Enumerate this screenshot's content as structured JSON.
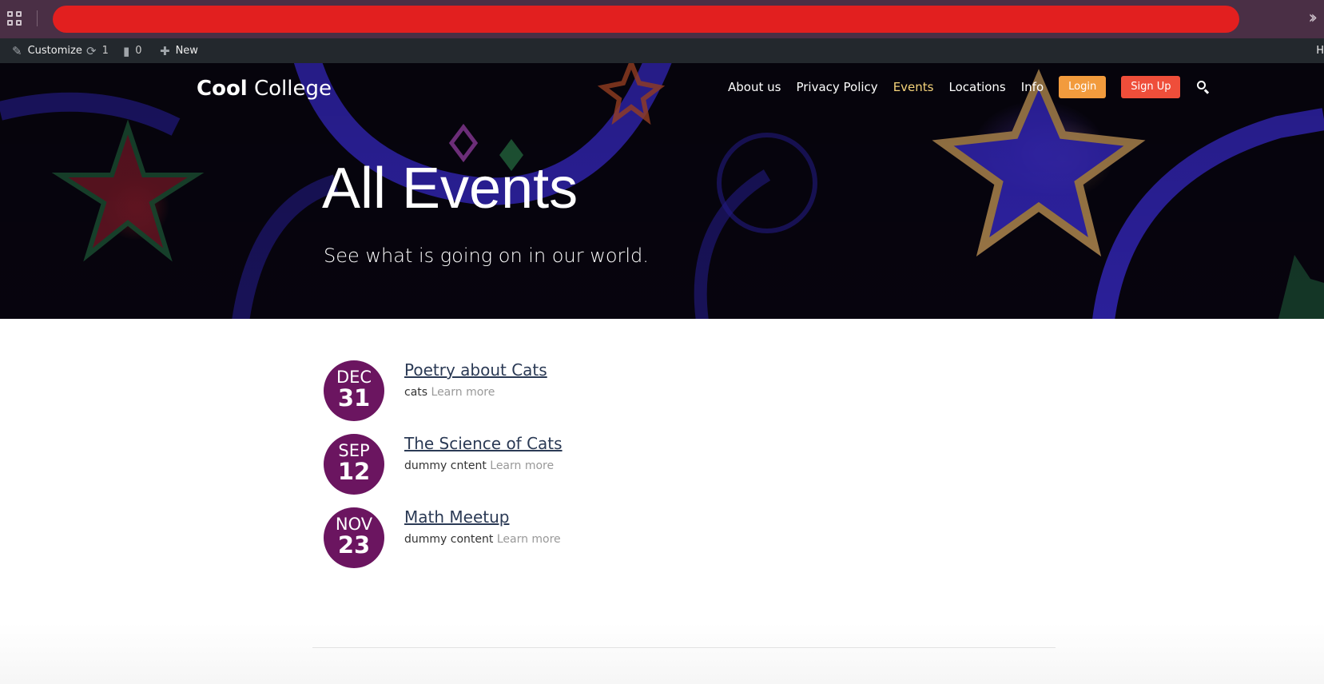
{
  "browser": {
    "apps_icon": "apps-grid-icon",
    "overflow_icon": "double-chevron-right-icon"
  },
  "admin_bar": {
    "customize_label": "Customize",
    "updates_count": "1",
    "comments_count": "0",
    "new_label": "New",
    "right_label": "H"
  },
  "site": {
    "logo_bold": "Cool",
    "logo_light": "College",
    "nav": {
      "about": "About us",
      "privacy": "Privacy Policy",
      "events": "Events",
      "locations": "Locations",
      "info": "Info",
      "login": "Login",
      "signup": "Sign Up"
    },
    "colors": {
      "login_button": "#f29b3d",
      "signup_button": "#ef4e3a",
      "active_nav": "#f5d37a",
      "date_badge": "#6b1560"
    }
  },
  "hero": {
    "title": "All Events",
    "subtitle": "See what is going on in our world."
  },
  "events": [
    {
      "month": "DEC",
      "day": "31",
      "title": "Poetry about Cats",
      "desc": "cats",
      "link": "Learn more"
    },
    {
      "month": "SEP",
      "day": "12",
      "title": "The Science of Cats",
      "desc": "dummy cntent",
      "link": "Learn more"
    },
    {
      "month": "NOV",
      "day": "23",
      "title": "Math Meetup",
      "desc": "dummy content",
      "link": "Learn more"
    }
  ]
}
